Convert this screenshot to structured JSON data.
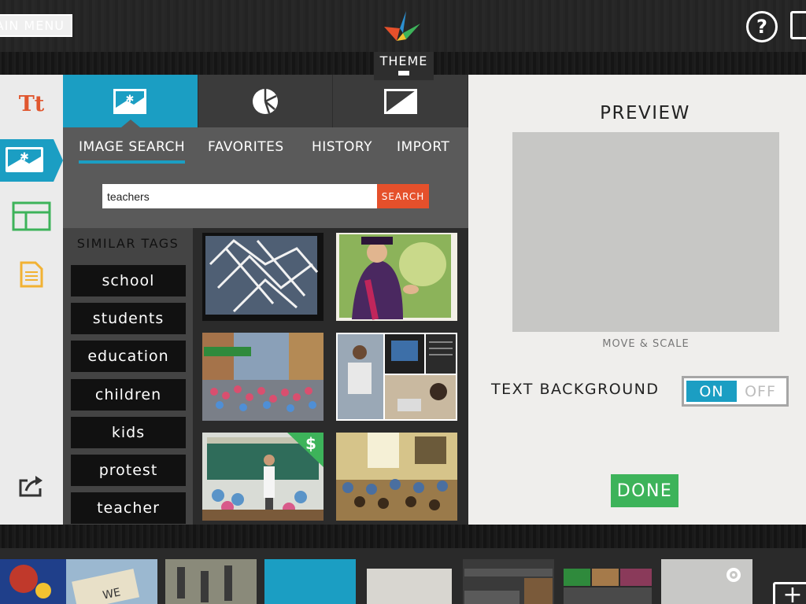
{
  "topbar": {
    "main_menu_label": "AIN MENU",
    "help_label": "?"
  },
  "theme_tab": {
    "label": "THEME"
  },
  "sidebar": {
    "text_label": "Tt"
  },
  "panel": {
    "sub_tabs": [
      {
        "label": "IMAGE SEARCH",
        "active": true
      },
      {
        "label": "FAVORITES",
        "active": false
      },
      {
        "label": "HISTORY",
        "active": false
      },
      {
        "label": "IMPORT",
        "active": false
      }
    ],
    "search": {
      "value": "teachers",
      "button_label": "SEARCH"
    },
    "tags": {
      "title": "SIMILAR TAGS",
      "items": [
        "school",
        "students",
        "education",
        "children",
        "kids",
        "protest",
        "teacher"
      ]
    },
    "premium_badge": "$"
  },
  "preview": {
    "title": "PREVIEW",
    "move_scale": "MOVE & SCALE",
    "text_background_label": "TEXT BACKGROUND",
    "toggle": {
      "on_label": "ON",
      "off_label": "OFF",
      "state": "on"
    },
    "done_label": "DONE"
  },
  "colors": {
    "accent_blue": "#1b9ec3",
    "search_orange": "#e5502b",
    "done_green": "#3db35a",
    "text_icon_red": "#e0572f"
  }
}
